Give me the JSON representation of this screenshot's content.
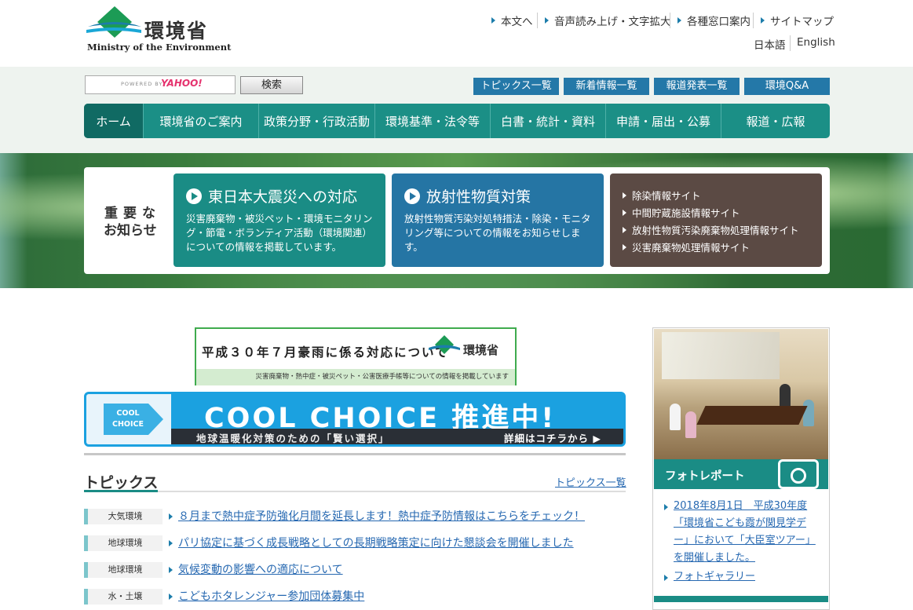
{
  "header": {
    "logo_jp": "環境省",
    "logo_en": "Ministry of the Environment",
    "util_links": [
      "本文へ",
      "音声読み上げ・文字拡大",
      "各種窓口案内",
      "サイトマップ"
    ],
    "lang": [
      "日本語",
      "English"
    ]
  },
  "search": {
    "powered": "POWERED BY",
    "yahoo": "YAHOO!",
    "button": "検索"
  },
  "top_buttons": [
    "トピックス一覧",
    "新着情報一覧",
    "報道発表一覧",
    "環境Q&A"
  ],
  "gnav": [
    "ホーム",
    "環境省のご案内",
    "政策分野・行政活動",
    "環境基準・法令等",
    "白書・統計・資料",
    "申請・届出・公募",
    "報道・広報"
  ],
  "notice": {
    "label1": "重要な",
    "label2": "お知らせ",
    "card1": {
      "title": "東日本大震災への対応",
      "desc": "災害廃棄物・被災ペット・環境モニタリング・節電・ボランティア活動（環境関連）についての情報を掲載しています。"
    },
    "card2": {
      "title": "放射性物質対策",
      "desc": "放射性物質汚染対処特措法・除染・モニタリング等についての情報をお知らせします。"
    },
    "card3": [
      "除染情報サイト",
      "中間貯蔵施設情報サイト",
      "放射性物質汚染廃棄物処理情報サイト",
      "災害廃棄物処理情報サイト"
    ]
  },
  "banner1": {
    "title": "平成３０年７月豪雨に係る対応について",
    "brand": "環境省",
    "sub": "災害廃棄物・熱中症・被災ペット・公害医療手帳等についての情報を掲載しています"
  },
  "banner2": {
    "logo": "COOL CHOICE",
    "big": "COOL CHOICE 推進中!",
    "sub": "地球温暖化対策のための「賢い選択」",
    "more": "詳細はコチラから ▶"
  },
  "topics": {
    "title": "トピックス",
    "all": "トピックス一覧",
    "items": [
      {
        "cat": "大気環境",
        "text": "８月まで熱中症予防強化月間を延長します！熱中症予防情報はこちらをチェック！"
      },
      {
        "cat": "地球環境",
        "text": "パリ協定に基づく成長戦略としての長期戦略策定に向けた懇談会を開催しました"
      },
      {
        "cat": "地球環境",
        "text": "気候変動の影響への適応について"
      },
      {
        "cat": "水・土壌",
        "text": "こどもホタレンジャー参加団体募集中"
      }
    ]
  },
  "side": {
    "photo_title": "フォトレポート",
    "links": [
      [
        "2018年8月1日　平成30年度",
        "「環境省こども霞が関見学デ",
        "ー」において「大臣室ツアー」",
        "を開催しました。"
      ],
      [
        "フォトギャラリー"
      ]
    ]
  }
}
